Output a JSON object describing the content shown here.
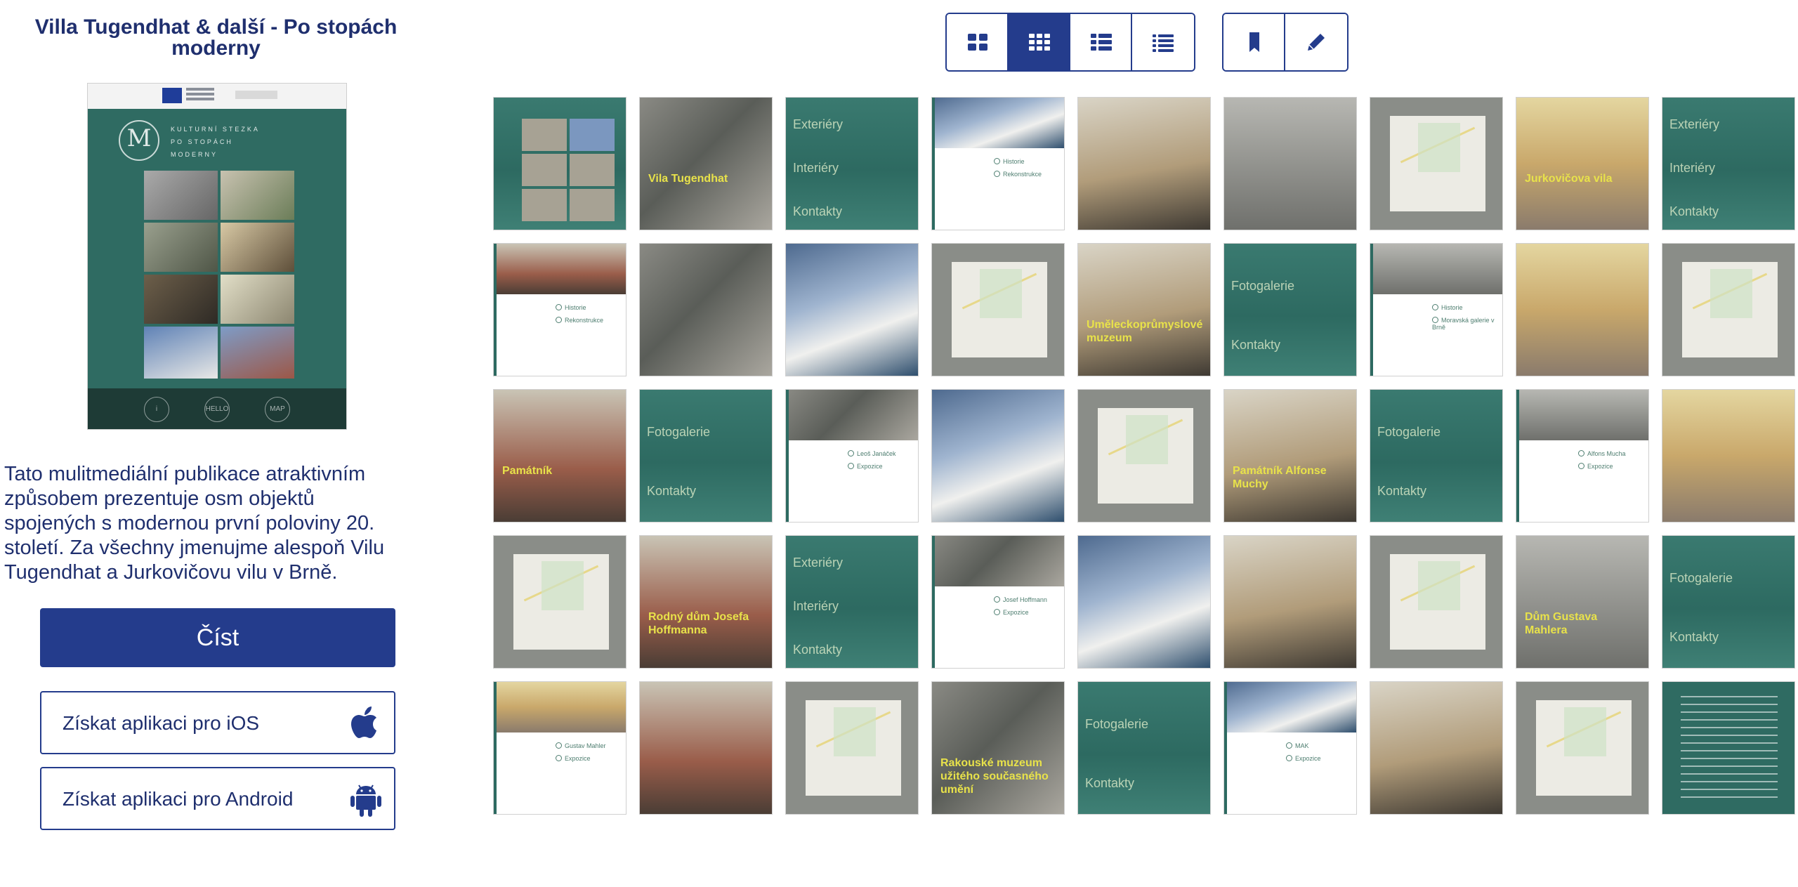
{
  "publication": {
    "title": "Villa Tugendhat & další - Po stopách moderny",
    "description": "Tato mulitmediální publikace atraktivním způsobem prezentuje osm objektů spojených s modernou první poloviny 20. století. Za všechny jmenujme alespoň Vilu Tugendhat a Jurkovičovu vilu v Brně.",
    "cover": {
      "headline_lines": [
        "KULTURNÍ STEZKA",
        "PO STOPÁCH",
        "MODERNY"
      ],
      "bottom_buttons": [
        "i",
        "HELLO",
        "MAP"
      ]
    }
  },
  "actions": {
    "read_label": "Číst",
    "ios_label": "Získat aplikaci pro iOS",
    "android_label": "Získat aplikaci pro Android"
  },
  "toolbar": {
    "view_buttons": [
      {
        "icon": "large-grid-icon",
        "active": false
      },
      {
        "icon": "small-grid-icon",
        "active": true
      },
      {
        "icon": "list-thumbnails-icon",
        "active": false
      },
      {
        "icon": "list-icon",
        "active": false
      }
    ],
    "tool_buttons": [
      {
        "icon": "bookmark-icon"
      },
      {
        "icon": "pencil-icon"
      }
    ]
  },
  "colors": {
    "brand": "#243c8c",
    "teal": "#2d6a61",
    "label_yellow": "#e8e24a"
  },
  "pages": [
    {
      "kind": "collage"
    },
    {
      "kind": "photo-label",
      "label": "Vila Tugendhat"
    },
    {
      "kind": "menu",
      "items": [
        "Exteriéry",
        "Interiéry",
        "Kontakty"
      ]
    },
    {
      "kind": "white-list",
      "bullets": [
        "Historie",
        "Rekonstrukce"
      ]
    },
    {
      "kind": "photo"
    },
    {
      "kind": "photo"
    },
    {
      "kind": "map"
    },
    {
      "kind": "photo-label",
      "label": "Jurkovičova vila"
    },
    {
      "kind": "menu",
      "items": [
        "Exteriéry",
        "Interiéry",
        "Kontakty"
      ]
    },
    {
      "kind": "white-list",
      "bullets": [
        "Historie",
        "Rekonstrukce"
      ]
    },
    {
      "kind": "photo"
    },
    {
      "kind": "photo"
    },
    {
      "kind": "map"
    },
    {
      "kind": "photo-label",
      "label": "Uměleckoprůmyslové muzeum"
    },
    {
      "kind": "menu",
      "items": [
        "Fotogalerie",
        "Kontakty"
      ]
    },
    {
      "kind": "white-list",
      "bullets": [
        "Historie",
        "Moravská galerie v Brně"
      ]
    },
    {
      "kind": "photo"
    },
    {
      "kind": "map"
    },
    {
      "kind": "photo-label",
      "label": "Památník"
    },
    {
      "kind": "menu",
      "items": [
        "Fotogalerie",
        "Kontakty"
      ]
    },
    {
      "kind": "white-list",
      "bullets": [
        "Leoš Janáček",
        "Expozice"
      ]
    },
    {
      "kind": "photo"
    },
    {
      "kind": "map"
    },
    {
      "kind": "photo-label",
      "label": "Památník Alfonse Muchy"
    },
    {
      "kind": "menu",
      "items": [
        "Fotogalerie",
        "Kontakty"
      ]
    },
    {
      "kind": "white-list",
      "bullets": [
        "Alfons Mucha",
        "Expozice"
      ]
    },
    {
      "kind": "photo"
    },
    {
      "kind": "map"
    },
    {
      "kind": "photo-label",
      "label": "Rodný dům Josefa Hoffmanna"
    },
    {
      "kind": "menu",
      "items": [
        "Exteriéry",
        "Interiéry",
        "Kontakty"
      ]
    },
    {
      "kind": "white-list",
      "bullets": [
        "Josef Hoffmann",
        "Expozice"
      ]
    },
    {
      "kind": "photo"
    },
    {
      "kind": "photo"
    },
    {
      "kind": "map"
    },
    {
      "kind": "photo-label",
      "label": "Dům Gustava Mahlera"
    },
    {
      "kind": "menu",
      "items": [
        "Fotogalerie",
        "Kontakty"
      ]
    },
    {
      "kind": "white-list",
      "bullets": [
        "Gustav Mahler",
        "Expozice"
      ]
    },
    {
      "kind": "photo"
    },
    {
      "kind": "map"
    },
    {
      "kind": "photo-label",
      "label": "Rakouské muzeum užitého současného umění"
    },
    {
      "kind": "menu",
      "items": [
        "Fotogalerie",
        "Kontakty"
      ]
    },
    {
      "kind": "white-list",
      "bullets": [
        "MAK",
        "Expozice"
      ]
    },
    {
      "kind": "photo"
    },
    {
      "kind": "map"
    },
    {
      "kind": "text"
    }
  ]
}
